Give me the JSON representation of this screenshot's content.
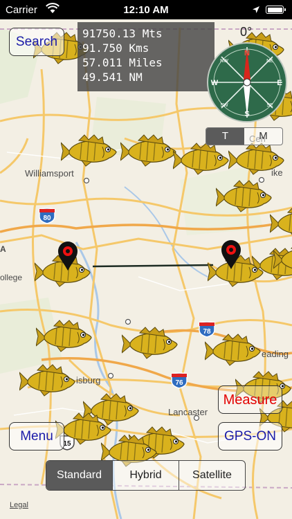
{
  "status_bar": {
    "carrier": "Carrier",
    "time": "12:10 AM",
    "battery_level": 1.0
  },
  "distance": {
    "meters": "91750.13 Mts",
    "kilometers": "91.750 Kms",
    "miles": "57.011 Miles",
    "nautical_miles": "49.541 NM"
  },
  "compass": {
    "heading": "0°",
    "cardinals": {
      "n": "N",
      "e": "E",
      "s": "S",
      "w": "W",
      "ne": "NE",
      "se": "SE",
      "sw": "SW",
      "nw": "NW"
    }
  },
  "tm_switch": {
    "t_label": "T",
    "m_label": "M",
    "selected": "T"
  },
  "buttons": {
    "search": "Search",
    "menu": "Menu",
    "measure": "Measure",
    "gps": "GPS-ON"
  },
  "map_type": {
    "options": [
      "Standard",
      "Hybrid",
      "Satellite"
    ],
    "selected": "Standard"
  },
  "map": {
    "labels": {
      "williamsport": "Williamsport",
      "ollege": "ollege",
      "a": "A",
      "lancaster": "Lancaster",
      "isburg": "isburg",
      "eading": "eading",
      "ike": "ike",
      "cen": "Cen"
    },
    "highways": {
      "i80": "80",
      "i78": "78",
      "i76": "76",
      "us15": "15"
    },
    "legal": "Legal"
  },
  "colors": {
    "map_background": "#f3efe4",
    "road_yellow": "#f5c86a",
    "interstate_blue": "#2f6cc0",
    "measure_red": "#e30000",
    "button_blue": "#1a1aa8"
  }
}
